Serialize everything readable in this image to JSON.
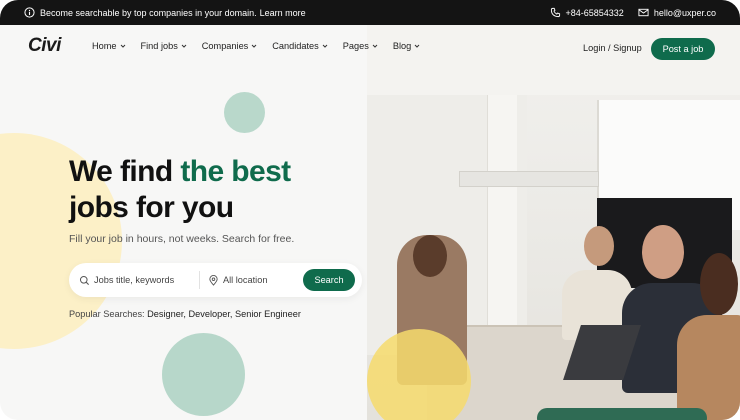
{
  "topbar": {
    "notice": "Become searchable by top companies in your domain.",
    "notice_link": "Learn more",
    "phone": "+84-65854332",
    "email": "hello@uxper.co"
  },
  "header": {
    "logo": "Civi",
    "nav": [
      {
        "label": "Home"
      },
      {
        "label": "Find jobs"
      },
      {
        "label": "Companies"
      },
      {
        "label": "Candidates"
      },
      {
        "label": "Pages"
      },
      {
        "label": "Blog"
      }
    ],
    "login": "Login / Signup",
    "post_job": "Post a job"
  },
  "hero": {
    "title_part1": "We find",
    "title_highlight": "the best",
    "title_line2": "jobs for you",
    "subtitle": "Fill your job in hours, not weeks. Search for free."
  },
  "search": {
    "keyword_placeholder": "Jobs title, keywords",
    "location_placeholder": "All location",
    "button": "Search"
  },
  "popular": {
    "label": "Popular Searches:",
    "tags": "Designer, Developer, Senior Engineer"
  },
  "colors": {
    "brand_green": "#0f6b4c",
    "highlight_yellow": "#f8dd78",
    "topbar_bg": "#141414"
  },
  "icons": [
    "info-icon",
    "phone-icon",
    "mail-icon",
    "chevron-down-icon",
    "search-icon",
    "location-pin-icon"
  ]
}
